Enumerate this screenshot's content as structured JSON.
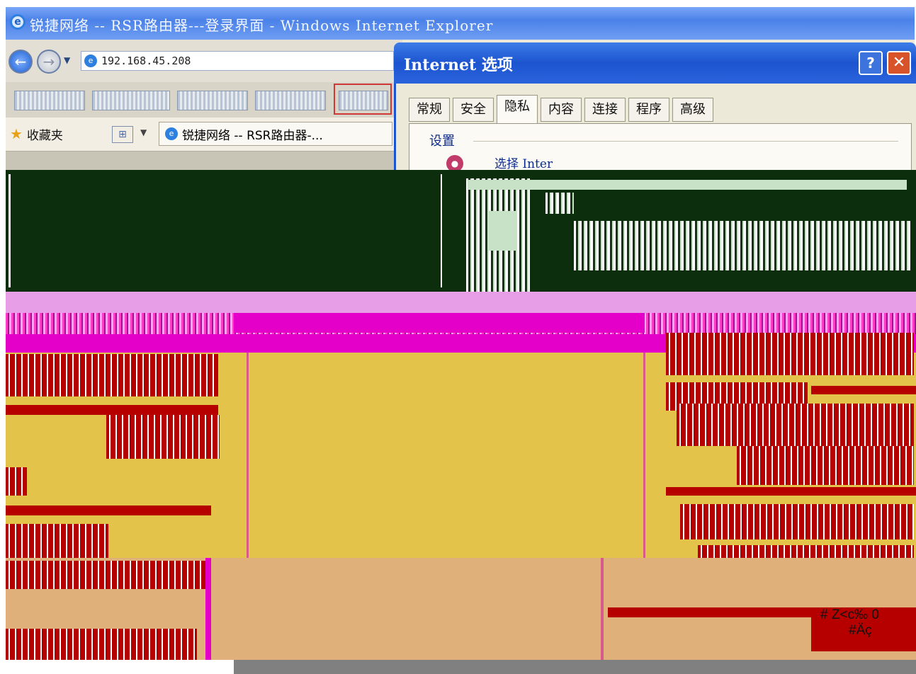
{
  "browser": {
    "window_title": "锐捷网络 -- RSR路由器---登录界面 - Windows Internet Explorer",
    "address_url": "192.168.45.208",
    "favorites_label": "收藏夹",
    "tab_title": "锐捷网络 -- RSR路由器-...",
    "logo_icon": "ie-logo-icon"
  },
  "dialog": {
    "title": "Internet 选项",
    "help_label": "?",
    "close_label": "✕",
    "tabs": [
      {
        "label": "常规"
      },
      {
        "label": "安全"
      },
      {
        "label": "隐私",
        "active": true
      },
      {
        "label": "内容"
      },
      {
        "label": "连接"
      },
      {
        "label": "程序"
      },
      {
        "label": "高级"
      }
    ],
    "settings_group_label": "设置",
    "select_label": "选择 Inter"
  },
  "overlay": {
    "status_line_1": "# Z<c‰ 0",
    "status_line_2": "#Äç"
  },
  "colors": {
    "glitch_dark": "#0c2e0c",
    "glitch_magenta": "#e400c8",
    "glitch_pink": "#e89ee6",
    "glitch_red": "#b60000",
    "glitch_yellow": "#e4c34a",
    "glitch_tan": "#dfb07a",
    "glitch_gray": "#808080"
  }
}
